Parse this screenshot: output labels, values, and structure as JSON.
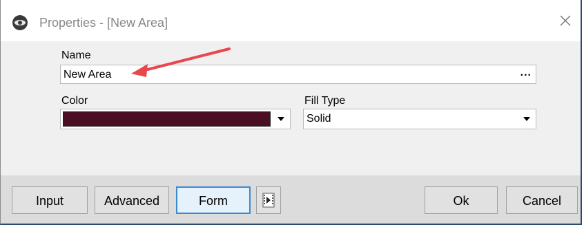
{
  "window": {
    "title": "Properties - [New Area]"
  },
  "form": {
    "name_label": "Name",
    "name_value": "New Area",
    "name_more_label": "...",
    "color_label": "Color",
    "color_value": "#4a0f22",
    "fill_type_label": "Fill Type",
    "fill_type_value": "Solid"
  },
  "buttons": {
    "input": "Input",
    "advanced": "Advanced",
    "form": "Form",
    "ok": "Ok",
    "cancel": "Cancel"
  },
  "icons": {
    "app": "app-logo-icon",
    "close": "close-icon",
    "media": "media-play-icon",
    "dropdown": "chevron-down-icon"
  },
  "colors": {
    "accent": "#3e88cf",
    "annotation_arrow": "#e8474c"
  }
}
